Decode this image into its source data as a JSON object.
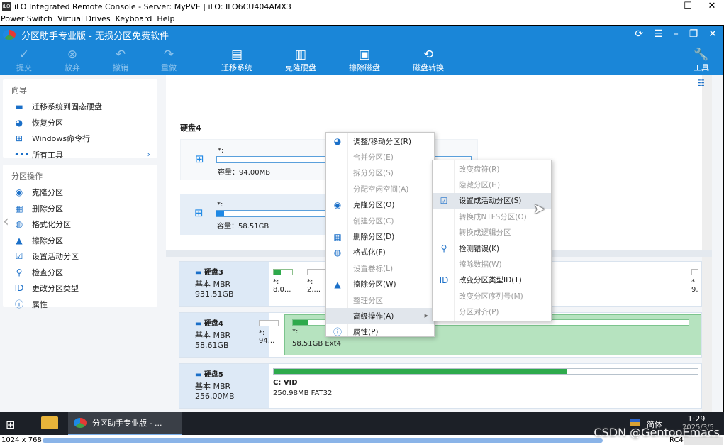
{
  "ilo": {
    "title": "iLO Integrated Remote Console - Server: MyPVE | iLO: ILO6CU404AMX3",
    "icon_text": "iLO",
    "menu": [
      "Power Switch",
      "Virtual Drives",
      "Keyboard",
      "Help"
    ],
    "status_resolution": "1024 x 768",
    "status_cipher": "RC4"
  },
  "app": {
    "title": "分区助手专业版 - 无损分区免费软件",
    "toolbar": {
      "commit": "提交",
      "discard": "放弃",
      "undo": "撤销",
      "redo": "重做",
      "migrate_os": "迁移系统",
      "clone_disk": "克隆硬盘",
      "wipe_disk": "擦除磁盘",
      "disk_convert": "磁盘转换",
      "tools": "工具"
    }
  },
  "sidebar": {
    "wizard_header": "向导",
    "wizard_items": [
      "迁移系统到固态硬盘",
      "恢复分区",
      "Windows命令行",
      "所有工具"
    ],
    "ops_header": "分区操作",
    "ops_items": [
      "克隆分区",
      "删除分区",
      "格式化分区",
      "擦除分区",
      "设置活动分区",
      "检查分区",
      "更改分区类型",
      "属性"
    ]
  },
  "upper": {
    "disk4_title": "硬盘4",
    "partitions": [
      {
        "name": "*:",
        "capacity": "容量：94.00MB",
        "fill": 0
      },
      {
        "name": "*:",
        "capacity": "容量：58.51GB",
        "fill": 0.03
      }
    ]
  },
  "disks": [
    {
      "name": "硬盘3",
      "type": "基本 MBR",
      "size": "931.51GB",
      "parts": [
        {
          "n": "*:",
          "v": "8.0..."
        },
        {
          "n": "*:",
          "v": "2...."
        }
      ],
      "tail": {
        "n": "*",
        "v": "9."
      }
    },
    {
      "name": "硬盘4",
      "type": "基本 MBR",
      "size": "58.61GB",
      "small": {
        "n": "*:",
        "v": "94..."
      },
      "big": {
        "n": "*:",
        "v": "58.51GB Ext4"
      }
    },
    {
      "name": "硬盘5",
      "type": "基本 MBR",
      "size": "256.00MB",
      "part": {
        "n": "C: VID",
        "v": "250.98MB FAT32"
      }
    }
  ],
  "context_menu": {
    "items": [
      {
        "label": "调整/移动分区(R)",
        "enabled": true,
        "icon": "resize-icon"
      },
      {
        "label": "合并分区(E)",
        "enabled": false
      },
      {
        "label": "拆分分区(S)",
        "enabled": false
      },
      {
        "label": "分配空闲空间(A)",
        "enabled": false
      },
      {
        "label": "克隆分区(O)",
        "enabled": true,
        "icon": "clone-icon"
      },
      {
        "label": "创建分区(C)",
        "enabled": false
      },
      {
        "label": "删除分区(D)",
        "enabled": true,
        "icon": "trash-icon"
      },
      {
        "label": "格式化(F)",
        "enabled": true,
        "icon": "format-icon"
      },
      {
        "label": "设置卷标(L)",
        "enabled": false
      },
      {
        "label": "擦除分区(W)",
        "enabled": true,
        "icon": "brush-icon"
      },
      {
        "label": "整理分区",
        "enabled": false
      },
      {
        "label": "高级操作(A)",
        "enabled": true,
        "highlighted": true
      },
      {
        "label": "属性(P)",
        "enabled": true,
        "icon": "info-icon"
      }
    ]
  },
  "submenu": {
    "items": [
      {
        "label": "改变盘符(R)",
        "enabled": false
      },
      {
        "label": "隐藏分区(H)",
        "enabled": false
      },
      {
        "label": "设置成活动分区(S)",
        "enabled": true,
        "highlighted": true,
        "icon": "active-icon"
      },
      {
        "label": "转换成NTFS分区(O)",
        "enabled": false
      },
      {
        "label": "转换成逻辑分区",
        "enabled": false
      },
      {
        "label": "检测错误(K)",
        "enabled": true,
        "icon": "check-icon"
      },
      {
        "label": "擦除数据(W)",
        "enabled": false
      },
      {
        "label": "改变分区类型ID(T)",
        "enabled": true,
        "icon": "id-icon"
      },
      {
        "label": "改变分区序列号(M)",
        "enabled": false
      },
      {
        "label": "分区对齐(P)",
        "enabled": false
      }
    ]
  },
  "taskbar": {
    "task_label": "分区助手专业版 - ...",
    "lang": "简体",
    "time": "1:29",
    "date": "2025/3/5"
  },
  "watermark": "CSDN @GentooEmacs"
}
